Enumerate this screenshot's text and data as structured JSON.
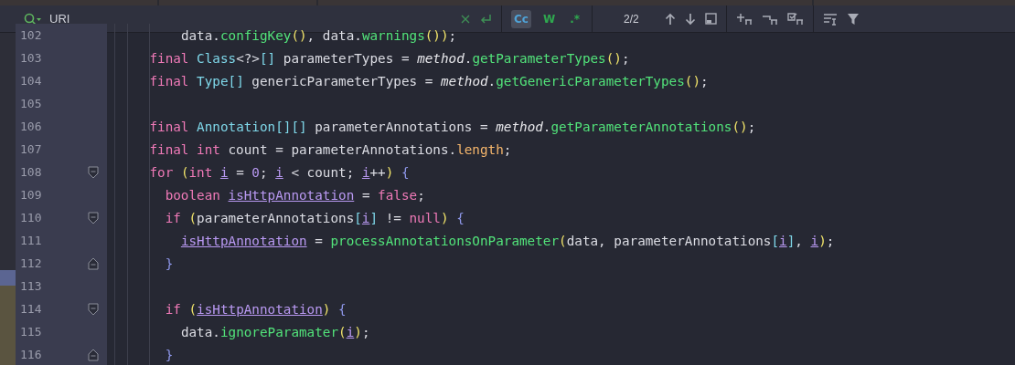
{
  "search": {
    "value": "URI",
    "toggles": [
      {
        "label": "Cc",
        "selected": true
      },
      {
        "label": "W",
        "selected": false
      },
      {
        "label": ".*",
        "selected": false
      }
    ],
    "count": "2/2"
  },
  "lines": [
    {
      "number": "102",
      "tokens": [
        {
          "kind": "plain",
          "text": "        data."
        },
        {
          "kind": "method",
          "text": "configKey"
        },
        {
          "kind": "paren",
          "text": "()"
        },
        {
          "kind": "plain",
          "text": ", data."
        },
        {
          "kind": "method",
          "text": "warnings"
        },
        {
          "kind": "paren",
          "text": "())"
        },
        {
          "kind": "plain",
          "text": ";"
        }
      ]
    },
    {
      "number": "103",
      "tokens": [
        {
          "kind": "keyword",
          "text": "    final "
        },
        {
          "kind": "type",
          "text": "Class"
        },
        {
          "kind": "plain",
          "text": "<?>"
        },
        {
          "kind": "type",
          "text": "[]"
        },
        {
          "kind": "plain",
          "text": " parameterTypes = "
        },
        {
          "kind": "italic",
          "text": "method"
        },
        {
          "kind": "plain",
          "text": "."
        },
        {
          "kind": "method",
          "text": "getParameterTypes"
        },
        {
          "kind": "paren",
          "text": "()"
        },
        {
          "kind": "plain",
          "text": ";"
        }
      ]
    },
    {
      "number": "104",
      "tokens": [
        {
          "kind": "keyword",
          "text": "    final "
        },
        {
          "kind": "type",
          "text": "Type[]"
        },
        {
          "kind": "plain",
          "text": " genericParameterTypes = "
        },
        {
          "kind": "italic",
          "text": "method"
        },
        {
          "kind": "plain",
          "text": "."
        },
        {
          "kind": "method",
          "text": "getGenericParameterTypes"
        },
        {
          "kind": "paren",
          "text": "()"
        },
        {
          "kind": "plain",
          "text": ";"
        }
      ]
    },
    {
      "number": "105"
    },
    {
      "number": "106",
      "tokens": [
        {
          "kind": "keyword",
          "text": "    final "
        },
        {
          "kind": "type",
          "text": "Annotation[][]"
        },
        {
          "kind": "plain",
          "text": " parameterAnnotations = "
        },
        {
          "kind": "italic",
          "text": "method"
        },
        {
          "kind": "plain",
          "text": "."
        },
        {
          "kind": "method",
          "text": "getParameterAnnotations"
        },
        {
          "kind": "paren",
          "text": "()"
        },
        {
          "kind": "plain",
          "text": ";"
        }
      ]
    },
    {
      "number": "107",
      "tokens": [
        {
          "kind": "keyword",
          "text": "    final int"
        },
        {
          "kind": "plain",
          "text": " count = parameterAnnotations."
        },
        {
          "kind": "field",
          "text": "length"
        },
        {
          "kind": "plain",
          "text": ";"
        }
      ]
    },
    {
      "number": "108",
      "fold_start": true,
      "tokens": [
        {
          "kind": "keyword",
          "text": "    for "
        },
        {
          "kind": "paren",
          "text": "("
        },
        {
          "kind": "keyword",
          "text": "int "
        },
        {
          "kind": "var",
          "text": "i"
        },
        {
          "kind": "plain",
          "text": " = "
        },
        {
          "kind": "number",
          "text": "0"
        },
        {
          "kind": "plain",
          "text": "; "
        },
        {
          "kind": "var",
          "text": "i"
        },
        {
          "kind": "plain",
          "text": " < count; "
        },
        {
          "kind": "var",
          "text": "i"
        },
        {
          "kind": "plain",
          "text": "++"
        },
        {
          "kind": "paren",
          "text": ")"
        },
        {
          "kind": "brace",
          "text": " {"
        }
      ]
    },
    {
      "number": "109",
      "tokens": [
        {
          "kind": "keyword",
          "text": "      boolean "
        },
        {
          "kind": "var",
          "text": "isHttpAnnotation"
        },
        {
          "kind": "plain",
          "text": " = "
        },
        {
          "kind": "keyword",
          "text": "false"
        },
        {
          "kind": "plain",
          "text": ";"
        }
      ]
    },
    {
      "number": "110",
      "fold_start": true,
      "tokens": [
        {
          "kind": "keyword",
          "text": "      if "
        },
        {
          "kind": "paren",
          "text": "("
        },
        {
          "kind": "plain",
          "text": "parameterAnnotations"
        },
        {
          "kind": "type",
          "text": "["
        },
        {
          "kind": "var",
          "text": "i"
        },
        {
          "kind": "type",
          "text": "]"
        },
        {
          "kind": "plain",
          "text": " != "
        },
        {
          "kind": "keyword",
          "text": "null"
        },
        {
          "kind": "paren",
          "text": ")"
        },
        {
          "kind": "brace",
          "text": " {"
        }
      ]
    },
    {
      "number": "111",
      "tokens": [
        {
          "kind": "var",
          "text": "        isHttpAnnotation"
        },
        {
          "kind": "plain",
          "text": " = "
        },
        {
          "kind": "method",
          "text": "processAnnotationsOnParameter"
        },
        {
          "kind": "paren",
          "text": "("
        },
        {
          "kind": "plain",
          "text": "data, parameterAnnotations"
        },
        {
          "kind": "type",
          "text": "["
        },
        {
          "kind": "var",
          "text": "i"
        },
        {
          "kind": "type",
          "text": "]"
        },
        {
          "kind": "plain",
          "text": ", "
        },
        {
          "kind": "var",
          "text": "i"
        },
        {
          "kind": "paren",
          "text": ")"
        },
        {
          "kind": "plain",
          "text": ";"
        }
      ]
    },
    {
      "number": "112",
      "fold_end": true,
      "tokens": [
        {
          "kind": "brace",
          "text": "      }"
        }
      ]
    },
    {
      "number": "113"
    },
    {
      "number": "114",
      "fold_start": true,
      "tokens": [
        {
          "kind": "keyword",
          "text": "      if "
        },
        {
          "kind": "paren",
          "text": "("
        },
        {
          "kind": "var",
          "text": "isHttpAnnotation"
        },
        {
          "kind": "paren",
          "text": ")"
        },
        {
          "kind": "brace",
          "text": " {"
        }
      ]
    },
    {
      "number": "115",
      "tokens": [
        {
          "kind": "plain",
          "text": "        data."
        },
        {
          "kind": "method",
          "text": "ignoreParamater"
        },
        {
          "kind": "paren",
          "text": "("
        },
        {
          "kind": "var",
          "text": "i"
        },
        {
          "kind": "paren",
          "text": ")"
        },
        {
          "kind": "plain",
          "text": ";"
        }
      ]
    },
    {
      "number": "116",
      "fold_end": true,
      "tokens": [
        {
          "kind": "brace",
          "text": "      }"
        }
      ]
    }
  ]
}
